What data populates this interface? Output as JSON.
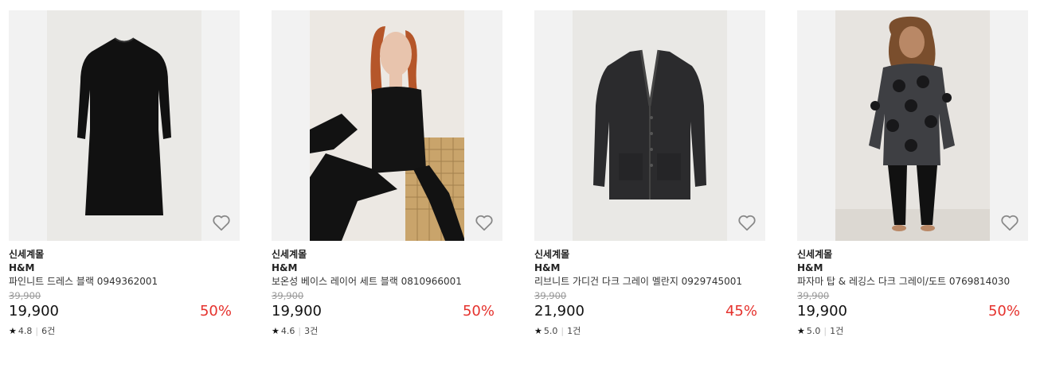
{
  "products": [
    {
      "mall": "신세계몰",
      "brand": "H&M",
      "name": "파인니트 드레스 블랙 0949362001",
      "original_price": "39,900",
      "price": "19,900",
      "discount": "50%",
      "rating": "4.8",
      "reviews": "6건"
    },
    {
      "mall": "신세계몰",
      "brand": "H&M",
      "name": "보온성 베이스 레이어 세트 블랙 0810966001",
      "original_price": "39,900",
      "price": "19,900",
      "discount": "50%",
      "rating": "4.6",
      "reviews": "3건"
    },
    {
      "mall": "신세계몰",
      "brand": "H&M",
      "name": "리브니트 가디건 다크 그레이 멜란지 0929745001",
      "original_price": "39,900",
      "price": "21,900",
      "discount": "45%",
      "rating": "5.0",
      "reviews": "1건"
    },
    {
      "mall": "신세계몰",
      "brand": "H&M",
      "name": "파자마 탑 & 레깅스 다크 그레이/도트 0769814030",
      "original_price": "39,900",
      "price": "19,900",
      "discount": "50%",
      "rating": "5.0",
      "reviews": "1건"
    }
  ],
  "icons": {
    "wishlist": "heart-outline-icon",
    "rating": "star-icon"
  },
  "colors": {
    "discount": "#e5322d",
    "original_price": "#999999"
  }
}
